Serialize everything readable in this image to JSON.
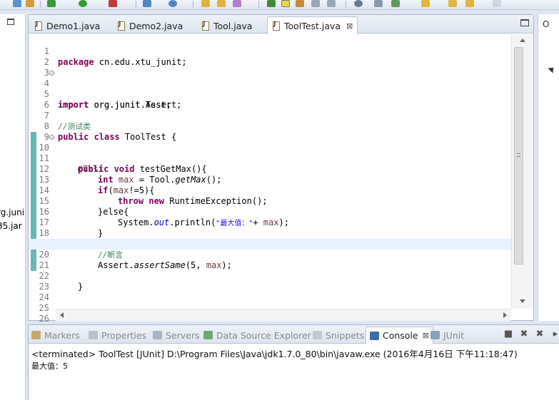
{
  "editor": {
    "tabs": [
      {
        "label": "Demo1.java",
        "active": false
      },
      {
        "label": "Demo2.java",
        "active": false
      },
      {
        "label": "Tool.java",
        "active": false
      },
      {
        "label": "ToolTest.java",
        "active": true
      }
    ],
    "close_glyph": "⊠",
    "lines": [
      {
        "n": "1"
      },
      {
        "n": "2"
      },
      {
        "n": "3"
      },
      {
        "n": "4"
      },
      {
        "n": "5"
      },
      {
        "n": "6"
      },
      {
        "n": "7"
      },
      {
        "n": "8"
      },
      {
        "n": "9"
      },
      {
        "n": "10"
      },
      {
        "n": "11"
      },
      {
        "n": "12"
      },
      {
        "n": "13"
      },
      {
        "n": "14"
      },
      {
        "n": "15"
      },
      {
        "n": "16"
      },
      {
        "n": "17"
      },
      {
        "n": "18"
      },
      {
        "n": "19"
      },
      {
        "n": "20"
      },
      {
        "n": "21"
      },
      {
        "n": "22"
      },
      {
        "n": "23"
      },
      {
        "n": "24"
      },
      {
        "n": "25"
      },
      {
        "n": "26"
      }
    ],
    "code": {
      "l1_kw": "package",
      "l1_rest": " cn.edu.xtu_junit;",
      "l4_kw": "import",
      "l4_rest": " org.junit.Assert;",
      "l5_kw": "import",
      "l5_rest": " org.junit.Test;",
      "l7_comment": "//测试类",
      "l8_kw": "public class",
      "l8_rest": " ToolTest {",
      "l10_ann": "@Test",
      "l11_kw": "public void",
      "l11_rest": " testGetMax(){",
      "l12_kw": "int",
      "l12_var": "max",
      "l12_mid": " = Tool.",
      "l12_method": "getMax",
      "l12_end": "();",
      "l13_kw": "if",
      "l13_paren": "(",
      "l13_var": "max",
      "l13_end": "!=5){",
      "l14_kw": "throw new",
      "l14_rest": " RuntimeException();",
      "l15_text": "}else{",
      "l16_pre": "System.",
      "l16_field": "out",
      "l16_mid": ".println(",
      "l16_str": "\"最大值：\"",
      "l16_plus": "+ ",
      "l16_var": "max",
      "l16_end": ");",
      "l17_text": "}",
      "l19_comment": "//断言",
      "l20_pre": "Assert.",
      "l20_method": "assertSame",
      "l20_mid": "(5, ",
      "l20_var": "max",
      "l20_end": ");",
      "l22_text": "}"
    }
  },
  "left_view": {
    "tree_item_1": "rg.juni",
    "tree_item_2": "35.jar"
  },
  "right_view": {
    "tab_stub": "O"
  },
  "console": {
    "tabs": [
      {
        "label": "Markers",
        "icon": "markers-icon"
      },
      {
        "label": "Properties",
        "icon": "properties-icon"
      },
      {
        "label": "Servers",
        "icon": "servers-icon"
      },
      {
        "label": "Data Source Explorer",
        "icon": "data-source-icon"
      },
      {
        "label": "Snippets",
        "icon": "snippets-icon"
      },
      {
        "label": "Console",
        "icon": "console-icon",
        "active": true
      },
      {
        "label": "JUnit",
        "icon": "junit-icon"
      }
    ],
    "status": "<terminated> ToolTest [JUnit] D:\\Program Files\\Java\\jdk1.7.0_80\\bin\\javaw.exe (2016年4月16日 下午11:18:47)",
    "output": "最大值：5"
  },
  "colors": {
    "keyword": "#7f0055",
    "comment": "#3f7f5f",
    "string": "#2a00ff",
    "local_var": "#6a3e3e",
    "coverage": "#68b9b4",
    "current_line": "#e8f2fe"
  }
}
